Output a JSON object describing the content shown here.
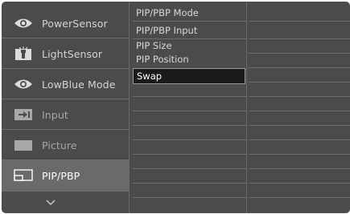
{
  "main_menu": {
    "items": [
      {
        "label": "PowerSensor",
        "icon": "eye-icon",
        "state": "normal"
      },
      {
        "label": "LightSensor",
        "icon": "light-sensor-icon",
        "state": "normal"
      },
      {
        "label": "LowBlue Mode",
        "icon": "eye-icon",
        "state": "normal"
      },
      {
        "label": "Input",
        "icon": "input-icon",
        "state": "dimmed"
      },
      {
        "label": "Picture",
        "icon": "picture-icon",
        "state": "dimmed"
      },
      {
        "label": "PIP/PBP",
        "icon": "pip-icon",
        "state": "selected"
      }
    ],
    "more_icon": "chevron-down-icon"
  },
  "sub_menu": {
    "items": [
      {
        "label": "PIP/PBP Mode"
      },
      {
        "label": "PIP/PBP Input"
      },
      {
        "label": "PIP Size"
      },
      {
        "label": "PIP Position"
      },
      {
        "label": "Swap",
        "selected": true
      }
    ]
  },
  "colors": {
    "background": "#4b4b4b",
    "selected_main": "#6a6a6a",
    "selected_sub": "#1a1a1a",
    "text": "#d4d4d4",
    "text_dimmed": "#a6a6a6"
  }
}
